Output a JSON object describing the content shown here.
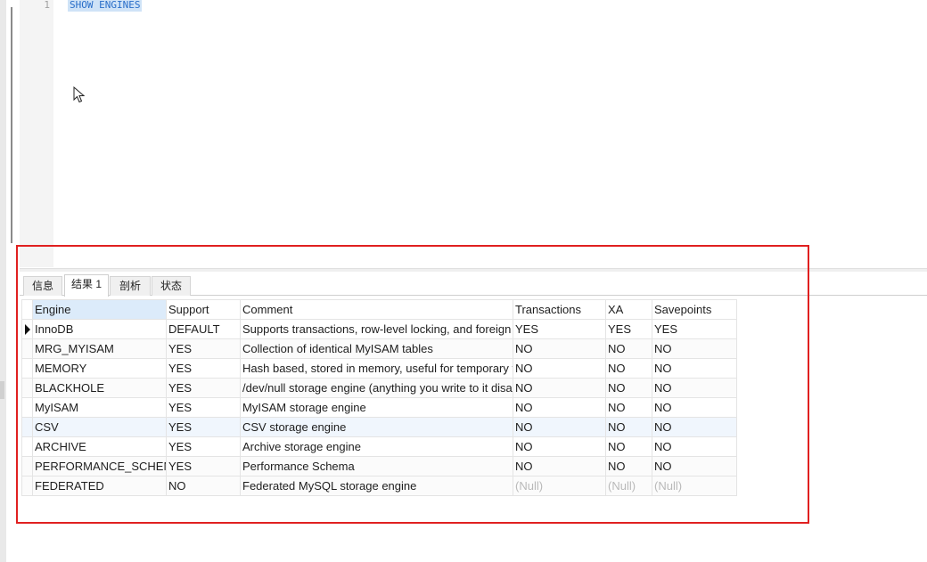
{
  "editor": {
    "line_number": "1",
    "sql": "SHOW ENGINES"
  },
  "tabs": [
    {
      "label": "信息",
      "active": false
    },
    {
      "label": "结果 1",
      "active": true
    },
    {
      "label": "剖析",
      "active": false
    },
    {
      "label": "状态",
      "active": false
    }
  ],
  "grid": {
    "columns": [
      "Engine",
      "Support",
      "Comment",
      "Transactions",
      "XA",
      "Savepoints"
    ],
    "rows": [
      [
        "InnoDB",
        "DEFAULT",
        "Supports transactions, row-level locking, and foreign keys",
        "YES",
        "YES",
        "YES"
      ],
      [
        "MRG_MYISAM",
        "YES",
        "Collection of identical MyISAM tables",
        "NO",
        "NO",
        "NO"
      ],
      [
        "MEMORY",
        "YES",
        "Hash based, stored in memory, useful for temporary tables",
        "NO",
        "NO",
        "NO"
      ],
      [
        "BLACKHOLE",
        "YES",
        "/dev/null storage engine (anything you write to it disappears)",
        "NO",
        "NO",
        "NO"
      ],
      [
        "MyISAM",
        "YES",
        "MyISAM storage engine",
        "NO",
        "NO",
        "NO"
      ],
      [
        "CSV",
        "YES",
        "CSV storage engine",
        "NO",
        "NO",
        "NO"
      ],
      [
        "ARCHIVE",
        "YES",
        "Archive storage engine",
        "NO",
        "NO",
        "NO"
      ],
      [
        "PERFORMANCE_SCHEMA",
        "YES",
        "Performance Schema",
        "NO",
        "NO",
        "NO"
      ],
      [
        "FEDERATED",
        "NO",
        "Federated MySQL storage engine",
        "(Null)",
        "(Null)",
        "(Null)"
      ]
    ]
  },
  "colors": {
    "highlight_box": "#e02020",
    "selection": "#cfe3f7",
    "sql_text": "#2a6fc9",
    "null_text": "#b9b9b9"
  }
}
